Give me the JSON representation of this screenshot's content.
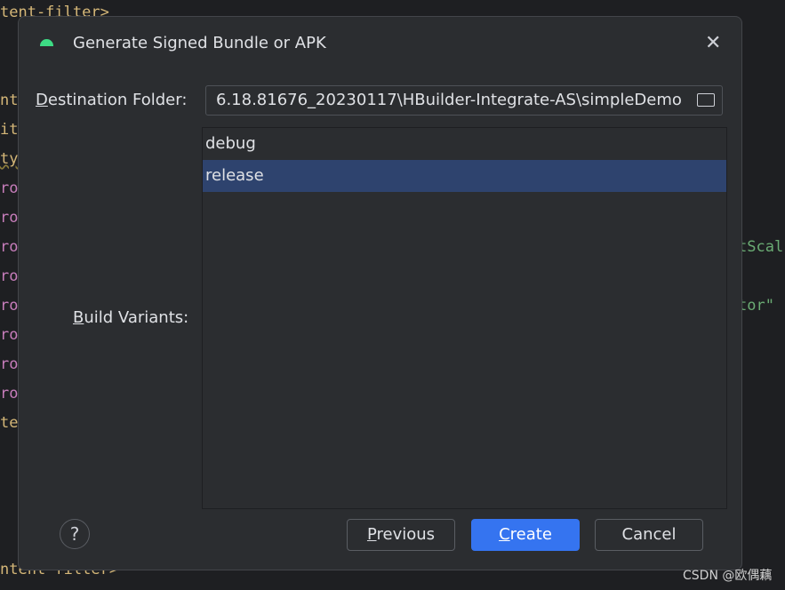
{
  "editor": {
    "lines": [
      "tent-filter>",
      "  <",
      "  <",
      "nt",
      "it",
      "ty",
      "ro",
      "ro",
      "ro",
      "ro",
      "ro",
      "ro",
      "ro",
      "ro",
      "te",
      "  <",
      "  <",
      "  <",
      "  <",
      "ntent-filter>"
    ],
    "right1": "tScal",
    "right2": "tor\""
  },
  "dialog": {
    "title": "Generate Signed Bundle or APK",
    "close_icon": "close-icon",
    "destination_label_mnemonic": "D",
    "destination_label_rest": "estination Folder:",
    "destination_value": "6.18.81676_20230117\\HBuilder-Integrate-AS\\simpleDemo",
    "variants_label_mnemonic": "B",
    "variants_label_rest": "uild Variants:",
    "variants": [
      "debug",
      "release"
    ],
    "selected_variant": "release",
    "previous_mn": "P",
    "previous_rest": "revious",
    "create_mn": "C",
    "create_rest": "reate",
    "cancel": "Cancel",
    "help": "?"
  },
  "watermark": "CSDN @欧偶藕",
  "colors": {
    "primary": "#3574f0",
    "selection": "#2e436e",
    "dialog_bg": "#2b2d30"
  }
}
